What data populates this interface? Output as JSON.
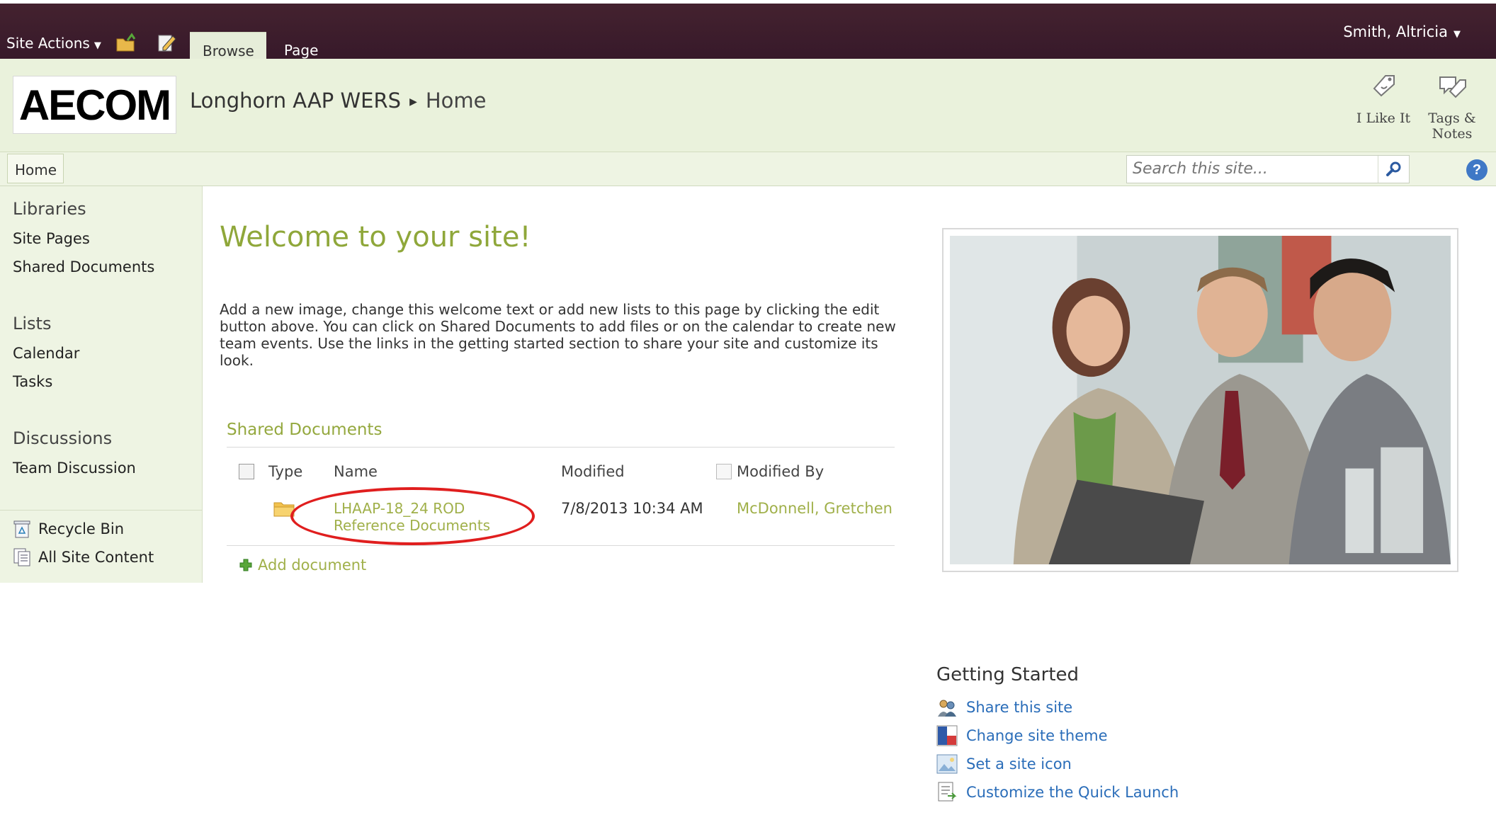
{
  "ribbon": {
    "site_actions": "Site Actions",
    "tabs": [
      "Browse",
      "Page"
    ],
    "user": "Smith, Altricia"
  },
  "header": {
    "logo_text": "AECOM",
    "site_title": "Longhorn AAP WERS",
    "current_page": "Home",
    "social": {
      "like_label": "I Like It",
      "tags_label": "Tags &\nNotes",
      "tags_line1": "Tags &",
      "tags_line2": "Notes"
    }
  },
  "topnav": {
    "home": "Home",
    "search_placeholder": "Search this site..."
  },
  "leftnav": {
    "sections": [
      {
        "heading": "Libraries",
        "items": [
          "Site Pages",
          "Shared Documents"
        ]
      },
      {
        "heading": "Lists",
        "items": [
          "Calendar",
          "Tasks"
        ]
      },
      {
        "heading": "Discussions",
        "items": [
          "Team Discussion"
        ]
      }
    ],
    "footer": [
      "Recycle Bin",
      "All Site Content"
    ]
  },
  "main": {
    "welcome": "Welcome to your site!",
    "intro": "Add a new image, change this welcome text or add new lists to this page by clicking the edit button above. You can click on Shared Documents to add files or on the calendar to create new team events. Use the links in the getting started section to share your site and customize its look.",
    "shared_docs": {
      "title": "Shared Documents",
      "columns": [
        "Type",
        "Name",
        "Modified",
        "Modified By"
      ],
      "rows": [
        {
          "name_line1": "LHAAP-18_24 ROD",
          "name_line2": "Reference Documents",
          "modified": "7/8/2013 10:34 AM",
          "modified_by": "McDonnell, Gretchen"
        }
      ],
      "add_document": "Add document"
    }
  },
  "getting_started": {
    "title": "Getting Started",
    "items": [
      "Share this site",
      "Change site theme",
      "Set a site icon",
      "Customize the Quick Launch"
    ]
  },
  "colors": {
    "ribbon": "#3c1e2c",
    "accent_green": "#8fa73a",
    "link_blue": "#2a6db9",
    "annotation_red": "#e01e1e"
  }
}
